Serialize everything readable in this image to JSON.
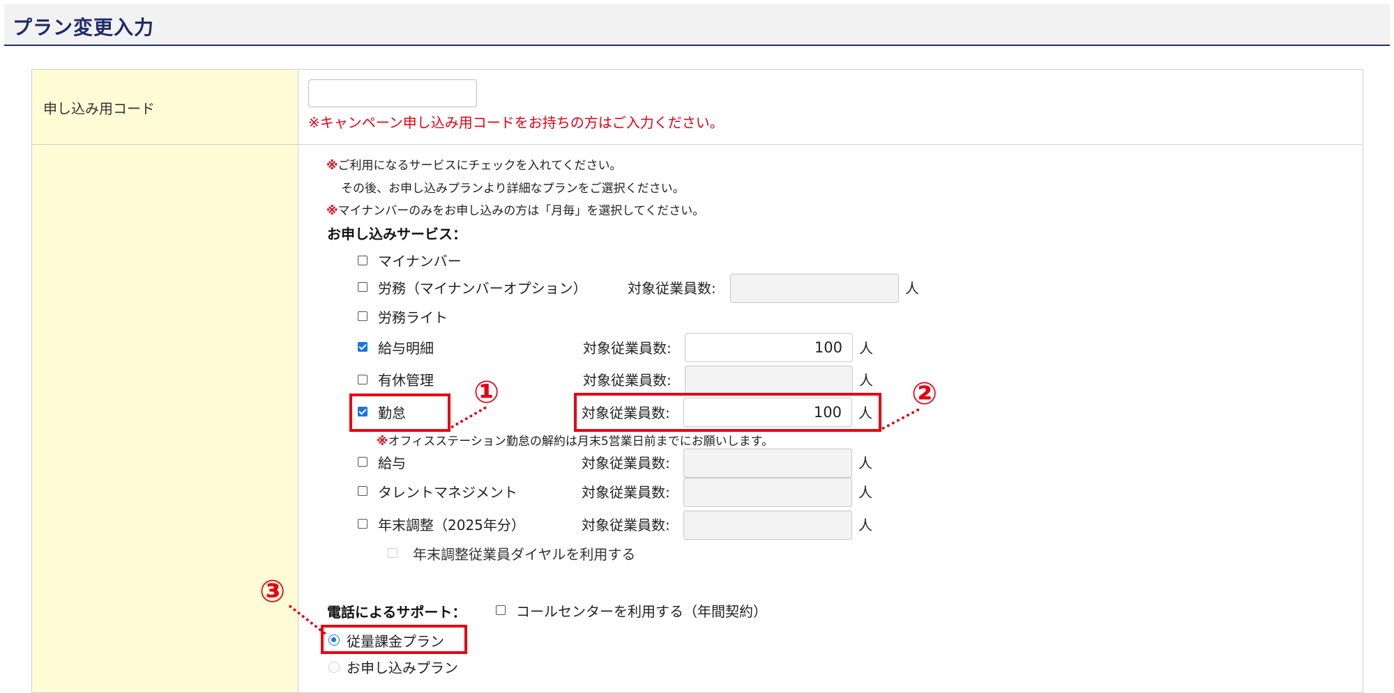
{
  "page": {
    "title": "プラン変更入力"
  },
  "campaign": {
    "label": "申し込み用コード",
    "value": "",
    "note": "※キャンペーン申し込み用コードをお持ちの方はご入力ください。"
  },
  "notes": {
    "mark": "※",
    "line1": "ご利用になるサービスにチェックを入れてください。",
    "line2": "その後、お申し込みプランより詳細なプランをご選択ください。",
    "line3": "マイナンバーのみをお申し込みの方は「月毎」を選択してください。"
  },
  "services": {
    "heading": "お申し込みサービス：",
    "employee_label": "対象従業員数:",
    "unit": "人",
    "items": [
      {
        "label": "マイナンバー",
        "checked": false
      },
      {
        "label": "労務（マイナンバーオプション）",
        "checked": false,
        "count": ""
      },
      {
        "label": "労務ライト",
        "checked": false
      },
      {
        "label": "給与明細",
        "checked": true,
        "count": "100"
      },
      {
        "label": "有休管理",
        "checked": false,
        "count": ""
      },
      {
        "label": "勤怠",
        "checked": true,
        "count": "100"
      },
      {
        "label": "給与",
        "checked": false,
        "count": ""
      },
      {
        "label": "タレントマネジメント",
        "checked": false,
        "count": ""
      },
      {
        "label": "年末調整（2025年分）",
        "checked": false,
        "count": ""
      }
    ],
    "kintai_note": "オフィスステーション勤怠の解約は月末5営業日前までにお願いします。",
    "nenmatsu_dial": {
      "label": "年末調整従業員ダイヤルを利用する",
      "checked": false,
      "disabled": true
    }
  },
  "phone_support": {
    "heading": "電話によるサポート：",
    "callcenter_label": "コールセンターを利用する（年間契約）",
    "callcenter_checked": false
  },
  "plans": {
    "options": [
      {
        "label": "従量課金プラン",
        "selected": true
      },
      {
        "label": "お申し込みプラン",
        "selected": false,
        "disabled": true
      }
    ]
  },
  "callouts": {
    "one": "①",
    "two": "②",
    "three": "③"
  },
  "colors": {
    "accent_red": "#e60012",
    "header_navy": "#1f2a6b",
    "label_bg": "#fffcd6",
    "checkbox_blue": "#1a73e8"
  }
}
